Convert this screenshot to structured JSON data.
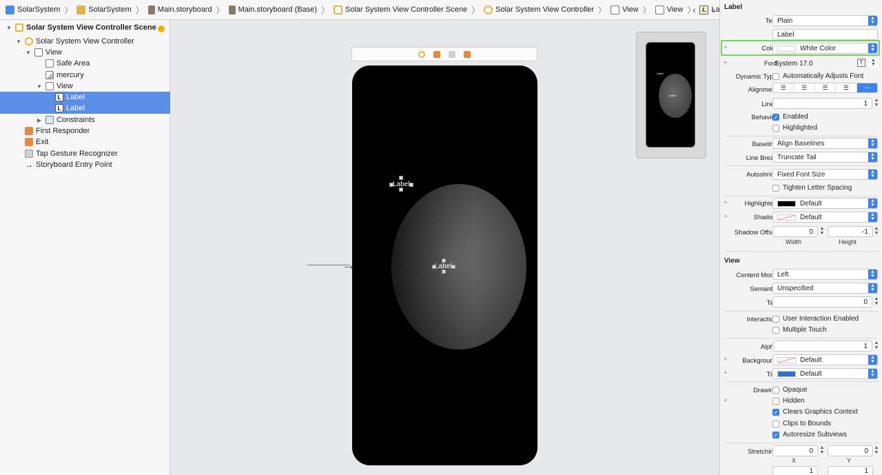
{
  "breadcrumb": [
    {
      "label": "SolarSystem",
      "icon": "project-icon"
    },
    {
      "label": "SolarSystem",
      "icon": "folder-icon"
    },
    {
      "label": "Main.storyboard",
      "icon": "storyboard-icon"
    },
    {
      "label": "Main.storyboard (Base)",
      "icon": "storyboard-icon"
    },
    {
      "label": "Solar System View Controller Scene",
      "icon": "scene-icon"
    },
    {
      "label": "Solar System View Controller",
      "icon": "view-controller-icon"
    },
    {
      "label": "View",
      "icon": "view-icon"
    },
    {
      "label": "View",
      "icon": "view-icon"
    },
    {
      "label": "Label",
      "icon": "label-icon"
    }
  ],
  "outline": {
    "items": [
      {
        "label": "Solar System View Controller Scene",
        "bold": true
      },
      {
        "label": "Solar System View Controller"
      },
      {
        "label": "View"
      },
      {
        "label": "Safe Area"
      },
      {
        "label": "mercury"
      },
      {
        "label": "View"
      },
      {
        "label": "Label"
      },
      {
        "label": "Label"
      },
      {
        "label": "Constraints"
      },
      {
        "label": "First Responder"
      },
      {
        "label": "Exit"
      },
      {
        "label": "Tap Gesture Recognizer"
      },
      {
        "label": "Storyboard Entry Point"
      }
    ]
  },
  "canvas": {
    "label_top": "Label",
    "label_center": "Label",
    "mini_label_top": "Label",
    "mini_label_center": "Label"
  },
  "inspector": {
    "label_section": "Label",
    "text_label": "Text",
    "text_value": "Plain",
    "text_content": "Label",
    "color_label": "Color",
    "color_value": "White Color",
    "font_label": "Font",
    "font_value": "System 17.0",
    "dyn_type_label": "Dynamic Type",
    "dyn_type_value": "Automatically Adjusts Font",
    "alignment_label": "Alignment",
    "lines_label": "Lines",
    "lines_value": "1",
    "behavior_label": "Behavior",
    "enabled": "Enabled",
    "highlighted": "Highlighted",
    "baseline_label": "Baseline",
    "baseline_value": "Align Baselines",
    "linebreak_label": "Line Break",
    "linebreak_value": "Truncate Tail",
    "autoshrink_label": "Autoshrink",
    "autoshrink_value": "Fixed Font Size",
    "tighten": "Tighten Letter Spacing",
    "highlighted_label": "Highlighted",
    "highlighted_value": "Default",
    "shadow_label": "Shadow",
    "shadow_value": "Default",
    "shadow_offset_label": "Shadow Offset",
    "shadow_w": "0",
    "shadow_h": "-1",
    "width_label": "Width",
    "height_label": "Height",
    "view_section": "View",
    "content_mode_label": "Content Mode",
    "content_mode_value": "Left",
    "semantic_label": "Semantic",
    "semantic_value": "Unspecified",
    "tag_label": "Tag",
    "tag_value": "0",
    "interaction_label": "Interaction",
    "user_interaction": "User Interaction Enabled",
    "multiple_touch": "Multiple Touch",
    "alpha_label": "Alpha",
    "alpha_value": "1",
    "background_label": "Background",
    "background_value": "Default",
    "tint_label": "Tint",
    "tint_value": "Default",
    "drawing_label": "Drawing",
    "opaque": "Opaque",
    "hidden": "Hidden",
    "clears": "Clears Graphics Context",
    "clips": "Clips to Bounds",
    "autoresize": "Autoresize Subviews",
    "stretching_label": "Stretching",
    "stretch_x": "0",
    "stretch_y": "0",
    "x_label": "X",
    "y_label": "Y",
    "stretch_w": "1",
    "stretch_h": "1"
  },
  "colors": {
    "selection": "#5b8fe6",
    "accent": "#3b82f0",
    "highlight_border": "#76d157"
  }
}
